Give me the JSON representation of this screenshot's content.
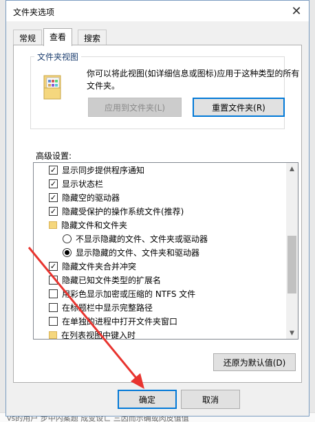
{
  "dialog": {
    "title": "文件夹选项",
    "close_icon": "close-icon"
  },
  "tabs": [
    {
      "label": "常规"
    },
    {
      "label": "查看"
    },
    {
      "label": "搜索"
    }
  ],
  "folder_views": {
    "group_label": "文件夹视图",
    "description": "你可以将此视图(如详细信息或图标)应用于这种类型的所有文件夹。",
    "apply_button": "应用到文件夹(L)",
    "reset_button": "重置文件夹(R)"
  },
  "advanced": {
    "label": "高级设置:",
    "items": [
      {
        "text": "显示同步提供程序通知",
        "type": "checkbox",
        "checked": true
      },
      {
        "text": "显示状态栏",
        "type": "checkbox",
        "checked": true
      },
      {
        "text": "隐藏空的驱动器",
        "type": "checkbox",
        "checked": true
      },
      {
        "text": "隐藏受保护的操作系统文件(推荐)",
        "type": "checkbox",
        "checked": true
      },
      {
        "text": "隐藏文件和文件夹",
        "type": "folder"
      },
      {
        "text": "不显示隐藏的文件、文件夹或驱动器",
        "type": "radio",
        "checked": false
      },
      {
        "text": "显示隐藏的文件、文件夹和驱动器",
        "type": "radio",
        "checked": true
      },
      {
        "text": "隐藏文件夹合并冲突",
        "type": "checkbox",
        "checked": true
      },
      {
        "text": "隐藏已知文件类型的扩展名",
        "type": "checkbox",
        "checked": false
      },
      {
        "text": "用彩色显示加密或压缩的 NTFS 文件",
        "type": "checkbox",
        "checked": false
      },
      {
        "text": "在标题栏中显示完整路径",
        "type": "checkbox",
        "checked": false
      },
      {
        "text": "在单独的进程中打开文件夹窗口",
        "type": "checkbox",
        "checked": false
      },
      {
        "text": "在列表视图中键入时",
        "type": "folder"
      }
    ],
    "restore_button": "还原为默认值(D)"
  },
  "footer": {
    "ok": "确定",
    "cancel": "取消"
  },
  "background_text": "vs的用户 步中内案题 成变设亡 三因而示确或肉皮值值",
  "colors": {
    "accent": "#0078d7",
    "annotation_arrow": "#e8342f"
  }
}
